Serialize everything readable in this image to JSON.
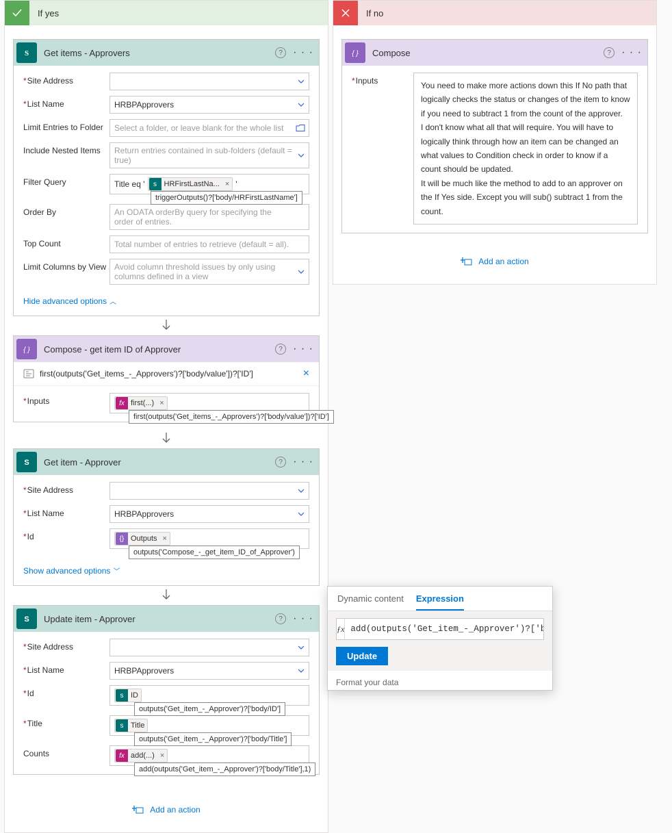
{
  "branches": {
    "yes": {
      "title": "If yes"
    },
    "no": {
      "title": "If no"
    }
  },
  "getItems": {
    "title": "Get items - Approvers",
    "fields": {
      "siteAddress": {
        "label": "Site Address",
        "value": ""
      },
      "listName": {
        "label": "List Name",
        "value": "HRBPApprovers"
      },
      "limitFolder": {
        "label": "Limit Entries to Folder",
        "placeholder": "Select a folder, or leave blank for the whole list"
      },
      "nested": {
        "label": "Include Nested Items",
        "placeholder": "Return entries contained in sub-folders (default = true)"
      },
      "filter": {
        "label": "Filter Query",
        "prefix": "Title eq '",
        "token": "HRFirstLastNa...",
        "tooltip": "triggerOutputs()?['body/HRFirstLastName']"
      },
      "orderBy": {
        "label": "Order By",
        "placeholder": "An ODATA orderBy query for specifying the order of entries."
      },
      "topCount": {
        "label": "Top Count",
        "placeholder": "Total number of entries to retrieve (default = all)."
      },
      "limitCols": {
        "label": "Limit Columns by View",
        "placeholder": "Avoid column threshold issues by only using columns defined in a view"
      }
    },
    "advLink": "Hide advanced options"
  },
  "composeId": {
    "title": "Compose - get item ID of Approver",
    "peek": "first(outputs('Get_items_-_Approvers')?['body/value'])?['ID']",
    "inputsLabel": "Inputs",
    "token": "first(...)",
    "tooltip": "first(outputs('Get_items_-_Approvers')?['body/value'])?['ID']"
  },
  "getItem": {
    "title": "Get item - Approver",
    "fields": {
      "siteAddress": {
        "label": "Site Address",
        "value": ""
      },
      "listName": {
        "label": "List Name",
        "value": "HRBPApprovers"
      },
      "id": {
        "label": "Id",
        "token": "Outputs",
        "tooltip": "outputs('Compose_-_get_item_ID_of_Approver')"
      }
    },
    "advLink": "Show advanced options"
  },
  "updateItem": {
    "title": "Update item - Approver",
    "fields": {
      "siteAddress": {
        "label": "Site Address"
      },
      "listName": {
        "label": "List Name",
        "value": "HRBPApprovers"
      },
      "id": {
        "label": "Id",
        "token": "ID",
        "tooltip": "outputs('Get_item_-_Approver')?['body/ID']"
      },
      "title": {
        "label": "Title",
        "token": "Title",
        "tooltip": "outputs('Get_item_-_Approver')?['body/Title']"
      },
      "counts": {
        "label": "Counts",
        "token": "add(...)",
        "tooltip": "add(outputs('Get_item_-_Approver')?['body/Title'],1)"
      }
    }
  },
  "addAction": "Add an action",
  "composeNo": {
    "title": "Compose",
    "inputsLabel": "Inputs",
    "p1": "You need to make more actions down this If No path that logically checks the status or changes of the item to know if you need to subtract 1 from the count of the approver.",
    "p2": "I don't know what all that will require. You will have to logically think through how an item can be changed an what values to Condition check in order to know if a count should be updated.",
    "p3": "It will be much like the method to add to an approver on the If Yes side. Except you will sub() subtract 1 from the count."
  },
  "expr": {
    "tabDynamic": "Dynamic content",
    "tabExpr": "Expression",
    "value": "add(outputs('Get_item_-_Approver')?['body/",
    "update": "Update",
    "footer": "Format your data"
  }
}
